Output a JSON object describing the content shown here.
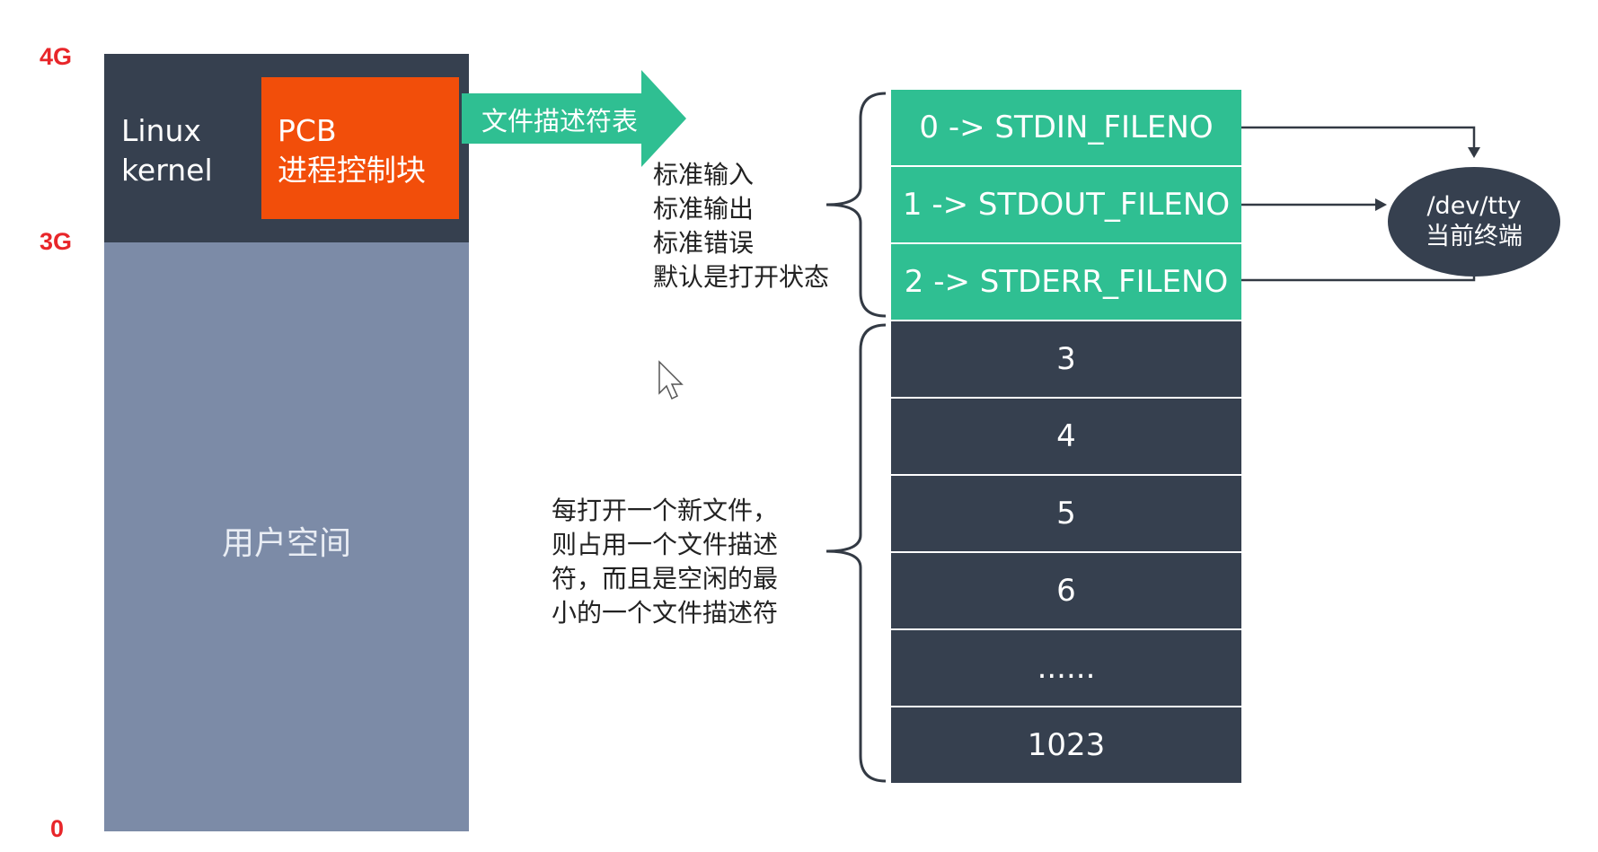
{
  "axis": {
    "top": "4G",
    "mid": "3G",
    "bottom": "0"
  },
  "memory": {
    "kernel_label": "Linux\nkernel",
    "pcb_line1": "PCB",
    "pcb_line2": "进程控制块",
    "user_label": "用户空间"
  },
  "arrow_label": "文件描述符表",
  "fd_table": {
    "std": [
      "0 -> STDIN_FILENO",
      "1 -> STDOUT_FILENO",
      "2 -> STDERR_FILENO"
    ],
    "free": [
      "3",
      "4",
      "5",
      "6",
      "......",
      "1023"
    ]
  },
  "notes": {
    "std_note": "标准输入\n标准输出\n标准错误\n默认是打开状态",
    "open_note": "每打开一个新文件，\n则占用一个文件描述\n符，而且是空闲的最\n小的一个文件描述符"
  },
  "tty": {
    "line1": "/dev/tty",
    "line2": "当前终端"
  },
  "colors": {
    "kernel": "#36404f",
    "user": "#7c8ba7",
    "pcb": "#f24e0a",
    "std_fd": "#2fbf92",
    "axis": "#e8262a"
  }
}
